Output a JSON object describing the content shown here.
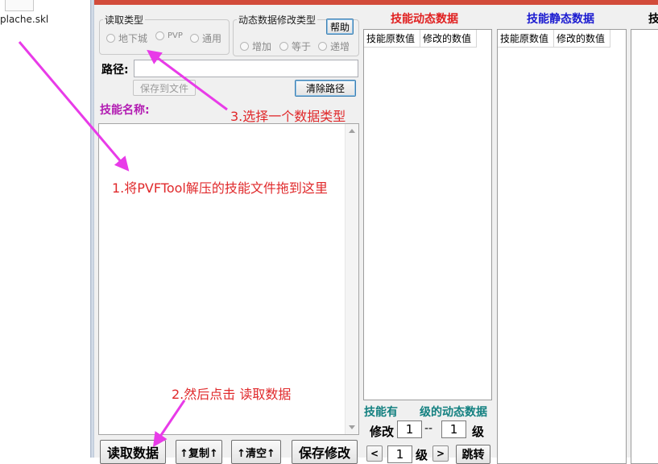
{
  "desktop": {
    "file_name": "plache.skl"
  },
  "read_type": {
    "legend": "读取类型",
    "options": [
      "地下城",
      "PVP",
      "通用"
    ]
  },
  "modify_type": {
    "legend": "动态数据修改类型",
    "help_label": "帮助",
    "options": [
      "增加",
      "等于",
      "递增"
    ]
  },
  "path": {
    "label": "路径:",
    "value": "",
    "save_file_label": "保存到文件",
    "clear_label": "清除路径"
  },
  "skill_name": {
    "label": "技能名称:"
  },
  "dynamic": {
    "title": "技能动态数据",
    "title_color": "#e02020",
    "col1": "技能原数值",
    "col2": "修改的数值",
    "has_levels_prefix": "技能有",
    "has_levels_suffix": "级的动态数据",
    "modify_label": "修改",
    "from_level": "1",
    "range_sep": "--",
    "to_level": "1",
    "level_unit": "级",
    "nav_prev": "<",
    "nav_value": "1",
    "nav_unit": "级",
    "nav_next": ">",
    "jump_label": "跳转"
  },
  "static": {
    "title": "技能静态数据",
    "title_color": "#1a1ad0",
    "col1": "技能原数值",
    "col2": "修改的数值"
  },
  "third_column": {
    "title_fragment": "技"
  },
  "bottom_buttons": {
    "read": "读取数据",
    "copy": "↑复制↑",
    "clear": "↑清空↑",
    "save": "保存修改"
  },
  "annotations": {
    "step1": "1.将PVFTool解压的技能文件拖到这里",
    "step2": "2.然后点击 读取数据",
    "step3": "3.选择一个数据类型",
    "color": "#e0292b",
    "arrow_color": "#e83be8"
  }
}
